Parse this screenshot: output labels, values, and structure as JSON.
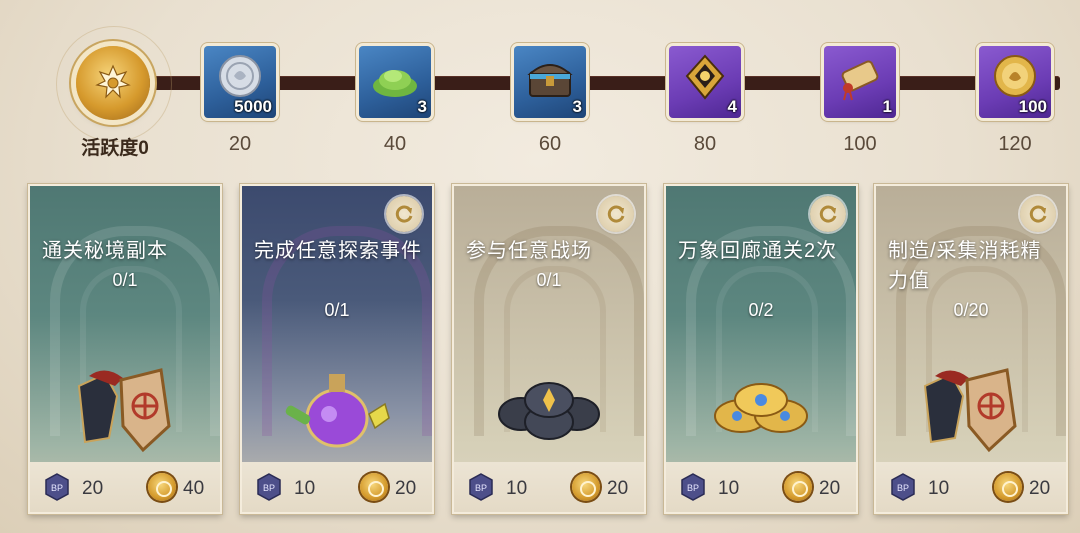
{
  "activity": {
    "label": "活跃度0",
    "value": 0
  },
  "milestones": [
    {
      "points": "20",
      "quantity": "5000",
      "icon": "silver-coin-icon",
      "rarity": "blue"
    },
    {
      "points": "40",
      "quantity": "3",
      "icon": "herb-pile-icon",
      "rarity": "blue"
    },
    {
      "points": "60",
      "quantity": "3",
      "icon": "treasure-chest-icon",
      "rarity": "blue"
    },
    {
      "points": "80",
      "quantity": "4",
      "icon": "gem-sigil-icon",
      "rarity": "purple"
    },
    {
      "points": "100",
      "quantity": "1",
      "icon": "scroll-icon",
      "rarity": "purple"
    },
    {
      "points": "120",
      "quantity": "100",
      "icon": "gold-medal-icon",
      "rarity": "purple"
    }
  ],
  "tasks": [
    {
      "title": "通关秘境副本",
      "progress": "0/1",
      "bp": "20",
      "coin": "40",
      "reward_icon": "armor-set-icon",
      "refreshable": false
    },
    {
      "title": "完成任意探索事件",
      "progress": "0/1",
      "bp": "10",
      "coin": "20",
      "reward_icon": "potion-icon",
      "refreshable": true
    },
    {
      "title": "参与任意战场",
      "progress": "0/1",
      "bp": "10",
      "coin": "20",
      "reward_icon": "rune-stones-icon",
      "refreshable": true
    },
    {
      "title": "万象回廊通关2次",
      "progress": "0/2",
      "bp": "10",
      "coin": "20",
      "reward_icon": "gold-coins-icon",
      "refreshable": true
    },
    {
      "title": "制造/采集消耗精力值",
      "progress": "0/20",
      "bp": "10",
      "coin": "20",
      "reward_icon": "armor-set-icon",
      "refreshable": true
    }
  ],
  "colors": {
    "track": "#3a1e18",
    "blue_rarity": "#2d5f9a",
    "purple_rarity": "#6b3cb4",
    "gold": "#d69a2d"
  }
}
